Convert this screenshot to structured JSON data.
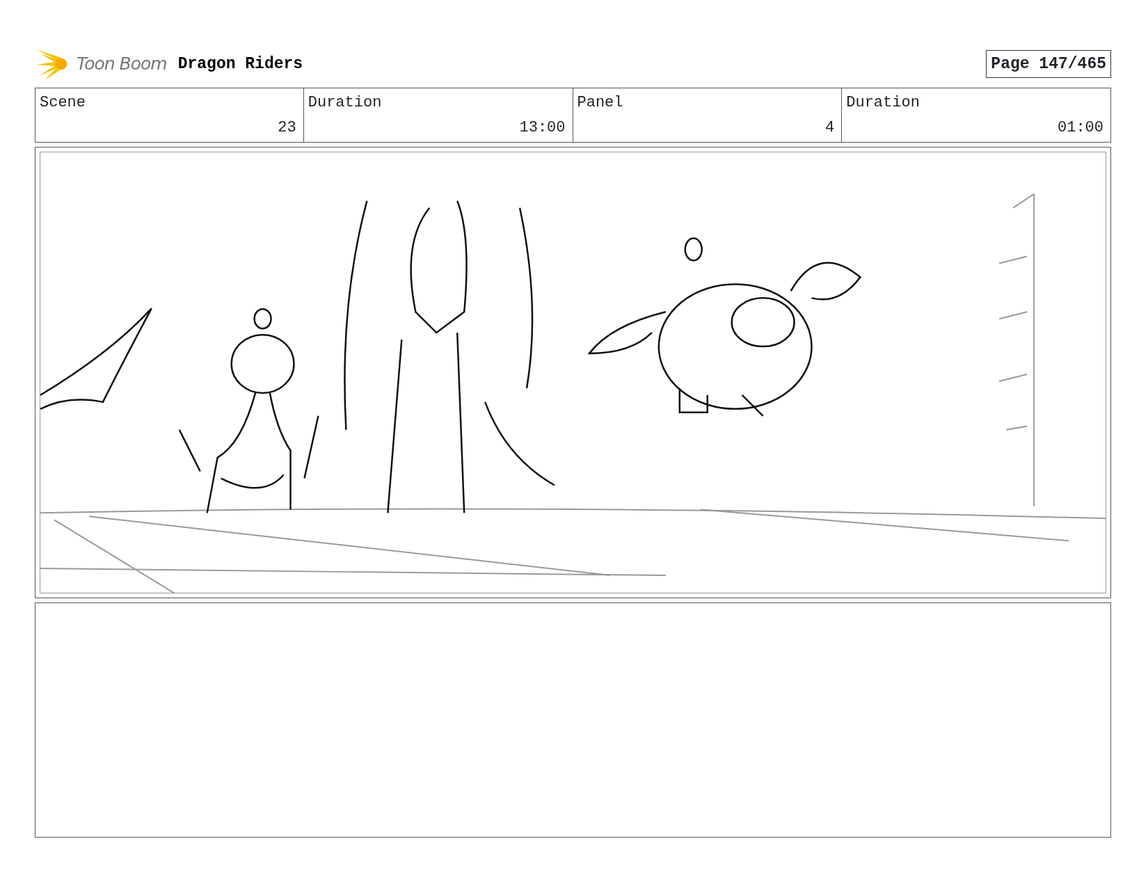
{
  "header": {
    "logo_text": "Toon Boom",
    "title": "Dragon Riders",
    "page": "Page 147/465"
  },
  "info_table": {
    "columns": [
      "Scene",
      "Duration",
      "Panel",
      "Duration"
    ],
    "rows": [
      [
        "23",
        "13:00",
        "4",
        "01:00"
      ]
    ]
  }
}
